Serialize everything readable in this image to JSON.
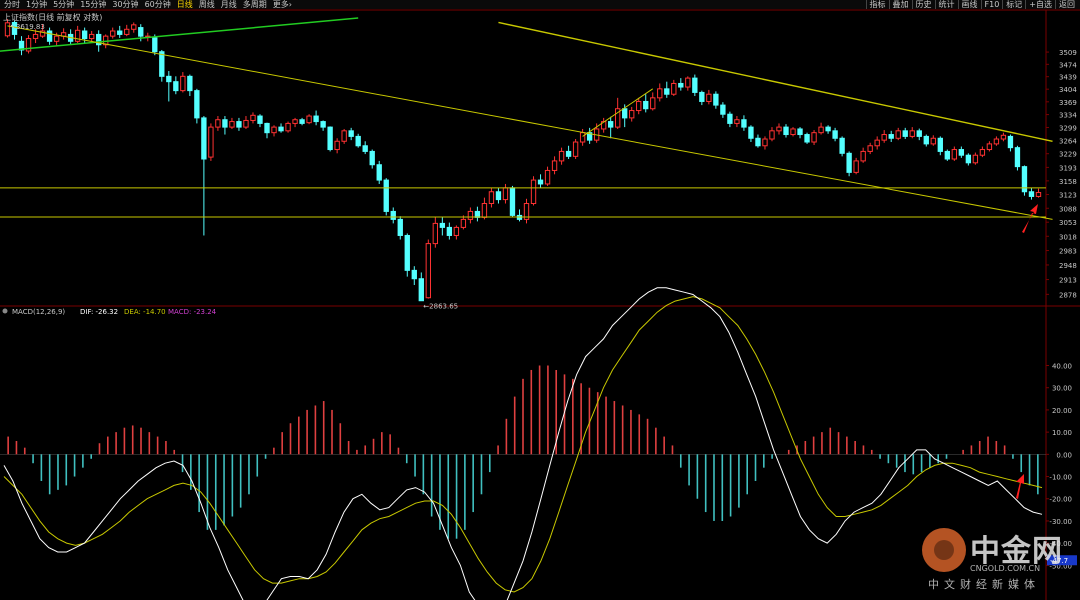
{
  "toolbar": {
    "left": [
      "分时",
      "1分钟",
      "5分钟",
      "15分钟",
      "30分钟",
      "60分钟",
      "日线",
      "周线",
      "月线",
      "多周期",
      "更多›"
    ],
    "active_index": 6,
    "right": [
      "指标",
      "叠加",
      "历史",
      "统计",
      "画线",
      "F10",
      "标记",
      "+自选",
      "返回"
    ]
  },
  "colors": {
    "up": "#ff3232",
    "down": "#54ffff",
    "trend": "#c8c800",
    "green_trend": "#22cc22",
    "grid": "#7a0000",
    "dif": "#ffffff",
    "dea": "#c8c800",
    "macd_label": "#d040d0",
    "arrow": "#ff2020"
  },
  "chart_data": [
    {
      "type": "candlestick",
      "title": "上证指数(日线 前复权 对数)",
      "ylim": [
        2860,
        3620
      ],
      "y_ticks": [
        "3509",
        "3474",
        "3439",
        "3404",
        "3369",
        "3334",
        "3299",
        "3264",
        "3229",
        "3193",
        "3158",
        "3123",
        "3088",
        "3053",
        "3018",
        "2983",
        "2948",
        "2913",
        "2878"
      ],
      "high_label": "3619.83",
      "low_label": "2863.65",
      "candles": [
        [
          3556,
          3594,
          3605,
          3551
        ],
        [
          3595,
          3560,
          3600,
          3545
        ],
        [
          3540,
          3515,
          3555,
          3500
        ],
        [
          3512,
          3548,
          3558,
          3505
        ],
        [
          3548,
          3560,
          3575,
          3535
        ],
        [
          3555,
          3570,
          3590,
          3550
        ],
        [
          3570,
          3540,
          3580,
          3530
        ],
        [
          3540,
          3555,
          3565,
          3528
        ],
        [
          3555,
          3565,
          3578,
          3545
        ],
        [
          3560,
          3540,
          3575,
          3530
        ],
        [
          3540,
          3572,
          3585,
          3535
        ],
        [
          3570,
          3548,
          3580,
          3535
        ],
        [
          3548,
          3560,
          3570,
          3540
        ],
        [
          3560,
          3530,
          3572,
          3510
        ],
        [
          3530,
          3555,
          3560,
          3520
        ],
        [
          3555,
          3570,
          3580,
          3548
        ],
        [
          3570,
          3560,
          3585,
          3550
        ],
        [
          3560,
          3575,
          3588,
          3555
        ],
        [
          3575,
          3588,
          3595,
          3565
        ],
        [
          3580,
          3555,
          3590,
          3540
        ],
        [
          3555,
          3555,
          3565,
          3540
        ],
        [
          3550,
          3510,
          3560,
          3500
        ],
        [
          3510,
          3440,
          3515,
          3425
        ],
        [
          3440,
          3425,
          3455,
          3370
        ],
        [
          3425,
          3400,
          3440,
          3390
        ],
        [
          3400,
          3440,
          3452,
          3395
        ],
        [
          3440,
          3400,
          3445,
          3385
        ],
        [
          3400,
          3325,
          3405,
          3310
        ],
        [
          3325,
          3215,
          3330,
          3020
        ],
        [
          3220,
          3300,
          3310,
          3210
        ],
        [
          3300,
          3320,
          3330,
          3290
        ],
        [
          3320,
          3300,
          3330,
          3280
        ],
        [
          3300,
          3315,
          3325,
          3295
        ],
        [
          3315,
          3300,
          3325,
          3290
        ],
        [
          3300,
          3318,
          3330,
          3295
        ],
        [
          3318,
          3332,
          3340,
          3310
        ],
        [
          3330,
          3310,
          3335,
          3300
        ],
        [
          3310,
          3285,
          3312,
          3270
        ],
        [
          3285,
          3300,
          3305,
          3275
        ],
        [
          3300,
          3290,
          3310,
          3285
        ],
        [
          3290,
          3310,
          3315,
          3285
        ],
        [
          3310,
          3320,
          3325,
          3300
        ],
        [
          3320,
          3310,
          3325,
          3305
        ],
        [
          3312,
          3330,
          3335,
          3308
        ],
        [
          3330,
          3315,
          3345,
          3305
        ],
        [
          3315,
          3300,
          3318,
          3290
        ],
        [
          3300,
          3240,
          3302,
          3235
        ],
        [
          3240,
          3262,
          3270,
          3230
        ],
        [
          3262,
          3290,
          3295,
          3255
        ],
        [
          3290,
          3275,
          3298,
          3265
        ],
        [
          3275,
          3250,
          3282,
          3245
        ],
        [
          3250,
          3235,
          3262,
          3228
        ],
        [
          3235,
          3200,
          3240,
          3190
        ],
        [
          3200,
          3160,
          3210,
          3150
        ],
        [
          3160,
          3080,
          3165,
          3070
        ],
        [
          3080,
          3060,
          3090,
          3050
        ],
        [
          3060,
          3020,
          3068,
          3010
        ],
        [
          3020,
          2935,
          3025,
          2920
        ],
        [
          2935,
          2915,
          2945,
          2900
        ],
        [
          2915,
          2863,
          2930,
          2863
        ],
        [
          2870,
          3000,
          3010,
          2868
        ],
        [
          3000,
          3050,
          3065,
          2990
        ],
        [
          3050,
          3040,
          3065,
          3020
        ],
        [
          3040,
          3020,
          3052,
          3010
        ],
        [
          3020,
          3040,
          3045,
          3010
        ],
        [
          3040,
          3060,
          3070,
          3035
        ],
        [
          3060,
          3080,
          3090,
          3050
        ],
        [
          3080,
          3065,
          3092,
          3055
        ],
        [
          3065,
          3100,
          3115,
          3060
        ],
        [
          3100,
          3130,
          3140,
          3090
        ],
        [
          3130,
          3110,
          3140,
          3100
        ],
        [
          3110,
          3140,
          3150,
          3100
        ],
        [
          3140,
          3070,
          3145,
          3065
        ],
        [
          3070,
          3060,
          3085,
          3055
        ],
        [
          3060,
          3100,
          3112,
          3050
        ],
        [
          3100,
          3160,
          3170,
          3095
        ],
        [
          3160,
          3150,
          3175,
          3140
        ],
        [
          3150,
          3185,
          3195,
          3145
        ],
        [
          3185,
          3210,
          3222,
          3175
        ],
        [
          3210,
          3235,
          3245,
          3200
        ],
        [
          3235,
          3222,
          3250,
          3215
        ],
        [
          3222,
          3260,
          3268,
          3215
        ],
        [
          3260,
          3285,
          3295,
          3250
        ],
        [
          3285,
          3265,
          3298,
          3255
        ],
        [
          3265,
          3295,
          3310,
          3258
        ],
        [
          3295,
          3315,
          3325,
          3285
        ],
        [
          3315,
          3300,
          3328,
          3270
        ],
        [
          3300,
          3350,
          3380,
          3295
        ],
        [
          3350,
          3325,
          3362,
          3300
        ],
        [
          3325,
          3345,
          3355,
          3315
        ],
        [
          3345,
          3370,
          3380,
          3335
        ],
        [
          3370,
          3350,
          3390,
          3340
        ],
        [
          3350,
          3380,
          3395,
          3345
        ],
        [
          3380,
          3405,
          3420,
          3370
        ],
        [
          3405,
          3390,
          3425,
          3380
        ],
        [
          3390,
          3420,
          3430,
          3385
        ],
        [
          3420,
          3410,
          3435,
          3400
        ],
        [
          3410,
          3435,
          3440,
          3400
        ],
        [
          3435,
          3395,
          3445,
          3385
        ],
        [
          3395,
          3370,
          3400,
          3360
        ],
        [
          3370,
          3390,
          3402,
          3362
        ],
        [
          3390,
          3360,
          3398,
          3350
        ],
        [
          3360,
          3335,
          3368,
          3325
        ],
        [
          3335,
          3310,
          3342,
          3300
        ],
        [
          3310,
          3320,
          3330,
          3300
        ],
        [
          3320,
          3300,
          3332,
          3290
        ],
        [
          3300,
          3270,
          3305,
          3260
        ],
        [
          3270,
          3250,
          3280,
          3245
        ],
        [
          3250,
          3268,
          3275,
          3240
        ],
        [
          3268,
          3290,
          3300,
          3262
        ],
        [
          3290,
          3300,
          3310,
          3280
        ],
        [
          3300,
          3280,
          3308,
          3272
        ],
        [
          3280,
          3295,
          3300,
          3275
        ],
        [
          3295,
          3280,
          3300,
          3270
        ],
        [
          3280,
          3260,
          3285,
          3255
        ],
        [
          3260,
          3285,
          3292,
          3252
        ],
        [
          3285,
          3300,
          3312,
          3280
        ],
        [
          3300,
          3290,
          3305,
          3282
        ],
        [
          3290,
          3270,
          3298,
          3262
        ],
        [
          3270,
          3230,
          3275,
          3222
        ],
        [
          3230,
          3180,
          3235,
          3170
        ],
        [
          3180,
          3210,
          3218,
          3175
        ],
        [
          3210,
          3235,
          3245,
          3205
        ],
        [
          3235,
          3250,
          3258,
          3228
        ],
        [
          3250,
          3265,
          3275,
          3240
        ],
        [
          3265,
          3280,
          3292,
          3258
        ],
        [
          3280,
          3270,
          3290,
          3260
        ],
        [
          3270,
          3290,
          3298,
          3265
        ],
        [
          3290,
          3275,
          3298,
          3268
        ],
        [
          3275,
          3290,
          3300,
          3270
        ],
        [
          3290,
          3275,
          3296,
          3265
        ],
        [
          3275,
          3255,
          3280,
          3248
        ],
        [
          3255,
          3270,
          3278,
          3250
        ],
        [
          3270,
          3235,
          3275,
          3225
        ],
        [
          3235,
          3215,
          3240,
          3210
        ],
        [
          3215,
          3240,
          3248,
          3210
        ],
        [
          3240,
          3225,
          3248,
          3218
        ],
        [
          3225,
          3205,
          3230,
          3198
        ],
        [
          3205,
          3225,
          3232,
          3200
        ],
        [
          3225,
          3240,
          3248,
          3220
        ],
        [
          3240,
          3255,
          3262,
          3235
        ],
        [
          3255,
          3268,
          3275,
          3250
        ],
        [
          3268,
          3278,
          3285,
          3262
        ],
        [
          3275,
          3245,
          3280,
          3235
        ],
        [
          3245,
          3195,
          3250,
          3185
        ],
        [
          3195,
          3130,
          3198,
          3120
        ],
        [
          3130,
          3118,
          3140,
          3110
        ],
        [
          3118,
          3128,
          3138,
          3115
        ]
      ]
    },
    {
      "type": "macd",
      "label": "MACD(12,26,9)",
      "dif_label": "DIF: -26.32",
      "dea_label": "DEA: -14.70",
      "macd_label": "MACD: -23.24",
      "ylim": [
        -62,
        65
      ],
      "y_ticks": [
        "40.00",
        "30.00",
        "20.00",
        "10.00",
        "0.00",
        "-10.00",
        "-20.00",
        "-30.00",
        "-40.00",
        "-50.00"
      ],
      "marker": "-47.7",
      "dif": [
        -5,
        -12,
        -22,
        -30,
        -38,
        -42,
        -44,
        -44,
        -42,
        -40,
        -35,
        -30,
        -25,
        -20,
        -16,
        -12,
        -9,
        -6,
        -4,
        -3,
        -5,
        -12,
        -22,
        -33,
        -42,
        -52,
        -60,
        -68,
        -72,
        -68,
        -62,
        -56,
        -55,
        -55,
        -56,
        -52,
        -45,
        -35,
        -26,
        -20,
        -18,
        -22,
        -25,
        -24,
        -20,
        -16,
        -15,
        -17,
        -22,
        -32,
        -42,
        -50,
        -62,
        -68,
        -70,
        -70,
        -68,
        -58,
        -48,
        -35,
        -20,
        -5,
        10,
        24,
        36,
        44,
        48,
        52,
        58,
        62,
        66,
        70,
        73,
        75,
        75,
        74,
        73,
        72,
        69,
        66,
        62,
        55,
        46,
        36,
        26,
        14,
        2,
        -8,
        -18,
        -28,
        -34,
        -38,
        -40,
        -36,
        -30,
        -26,
        -24,
        -22,
        -18,
        -12,
        -6,
        -2,
        2,
        2,
        -2,
        -4,
        -6,
        -8,
        -10,
        -12,
        -14,
        -12,
        -16,
        -20,
        -24,
        -26,
        -27
      ],
      "dea": [
        -10,
        -14,
        -18,
        -24,
        -30,
        -35,
        -38,
        -40,
        -41,
        -40,
        -38,
        -36,
        -33,
        -30,
        -26,
        -23,
        -20,
        -18,
        -16,
        -14,
        -13,
        -14,
        -17,
        -22,
        -28,
        -34,
        -40,
        -46,
        -52,
        -56,
        -58,
        -58,
        -57,
        -56,
        -56,
        -55,
        -53,
        -49,
        -44,
        -39,
        -34,
        -31,
        -29,
        -28,
        -26,
        -24,
        -22,
        -21,
        -21,
        -23,
        -27,
        -33,
        -40,
        -47,
        -53,
        -58,
        -61,
        -62,
        -60,
        -56,
        -48,
        -38,
        -26,
        -14,
        -2,
        10,
        20,
        30,
        38,
        44,
        50,
        56,
        60,
        64,
        67,
        69,
        70,
        71,
        70,
        68,
        66,
        62,
        58,
        52,
        45,
        37,
        28,
        18,
        8,
        -2,
        -10,
        -18,
        -24,
        -28,
        -28,
        -27,
        -26,
        -25,
        -23,
        -20,
        -17,
        -14,
        -10,
        -7,
        -5,
        -4,
        -4,
        -5,
        -6,
        -8,
        -9,
        -10,
        -11,
        -12,
        -13,
        -14,
        -15
      ],
      "hist": [
        8,
        6,
        3,
        -4,
        -12,
        -18,
        -16,
        -14,
        -10,
        -6,
        -2,
        5,
        8,
        10,
        12,
        13,
        12,
        10,
        8,
        6,
        2,
        -8,
        -16,
        -26,
        -34,
        -34,
        -32,
        -28,
        -24,
        -18,
        -10,
        -2,
        3,
        10,
        14,
        17,
        20,
        22,
        24,
        20,
        14,
        6,
        2,
        4,
        7,
        10,
        9,
        3,
        -4,
        -10,
        -18,
        -28,
        -34,
        -38,
        -38,
        -34,
        -26,
        -18,
        -8,
        4,
        16,
        26,
        34,
        38,
        40,
        40,
        38,
        36,
        34,
        32,
        30,
        28,
        26,
        24,
        22,
        20,
        18,
        16,
        12,
        8,
        4,
        -6,
        -14,
        -20,
        -26,
        -30,
        -30,
        -28,
        -24,
        -18,
        -12,
        -6,
        -2,
        0,
        2,
        4,
        6,
        8,
        10,
        12,
        10,
        8,
        6,
        4,
        2,
        -2,
        -4,
        -6,
        -8,
        -9,
        -8,
        -6,
        -4,
        -2,
        0,
        2,
        4,
        6,
        8,
        6,
        4,
        -2,
        -8,
        -14,
        -18
      ],
      "hist_note": "downsampled bar heights"
    }
  ],
  "watermark": {
    "name": "中金网",
    "url": "CNGOLD.COM.CN",
    "sub": "中文财经新媒体"
  }
}
